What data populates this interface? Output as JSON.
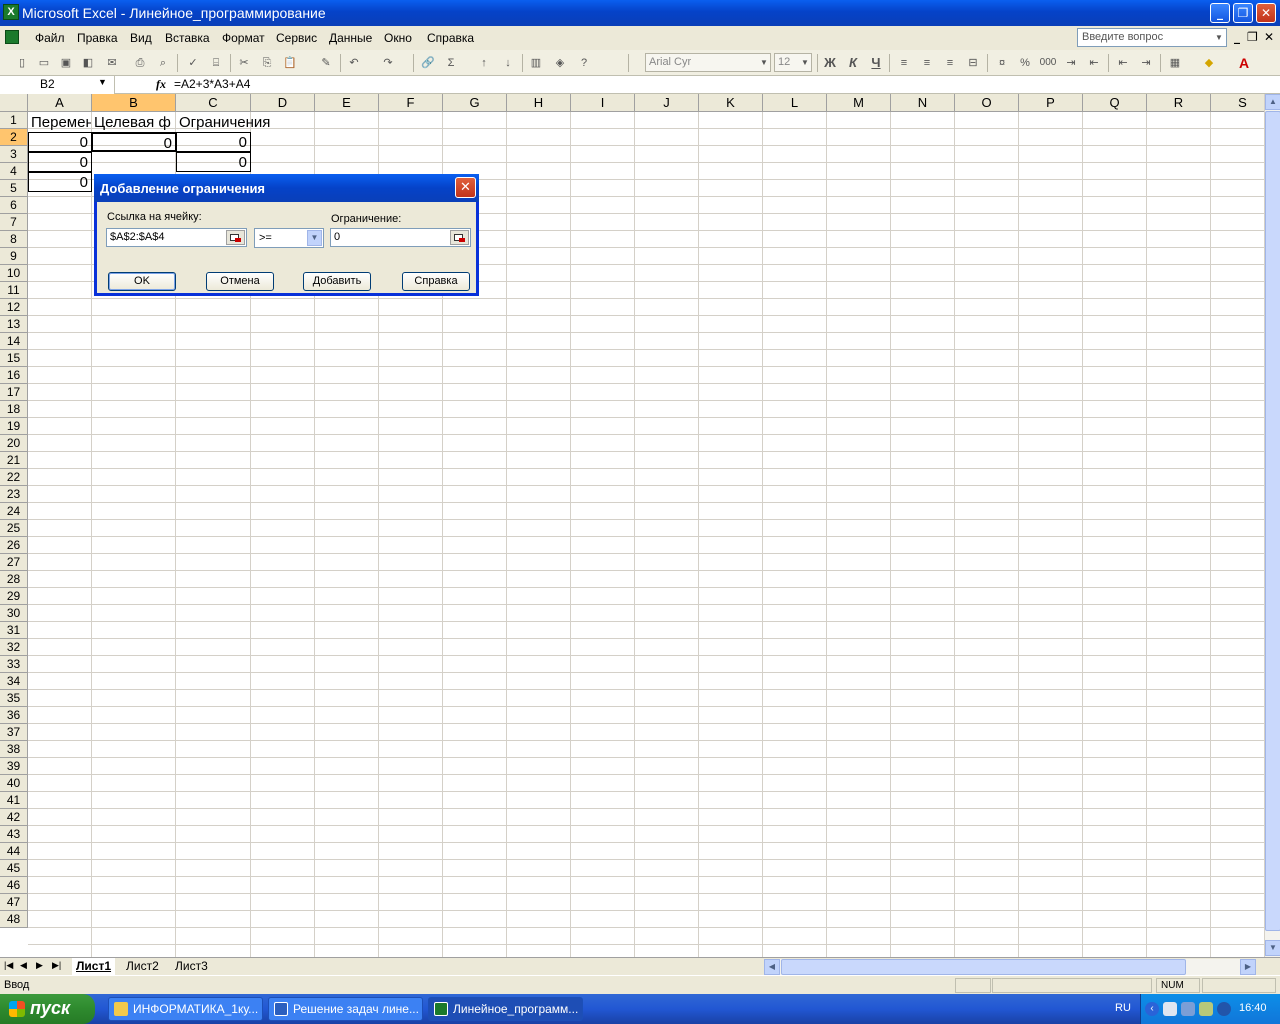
{
  "window": {
    "title": "Microsoft Excel - Линейное_программирование"
  },
  "menu": {
    "items": [
      "Файл",
      "Правка",
      "Вид",
      "Вставка",
      "Формат",
      "Сервис",
      "Данные",
      "Окно",
      "Справка"
    ],
    "help_placeholder": "Введите вопрос"
  },
  "toolbar": {
    "font_name": "Arial Cyr",
    "font_size": "12",
    "bold": "Ж",
    "italic": "К",
    "underline": "Ч",
    "percent": "%",
    "thousands": "000"
  },
  "formula_bar": {
    "name_box": "B2",
    "fx": "fx",
    "formula": "=A2+3*A3+A4"
  },
  "grid": {
    "columns": [
      "A",
      "B",
      "C",
      "D",
      "E",
      "F",
      "G",
      "H",
      "I",
      "J",
      "K",
      "L",
      "M",
      "N",
      "O",
      "P",
      "Q",
      "R",
      "S"
    ],
    "rows": [
      "1",
      "2",
      "3",
      "4",
      "5",
      "6",
      "7",
      "8",
      "9",
      "10",
      "11",
      "12",
      "13",
      "14",
      "15",
      "16",
      "17",
      "18",
      "19",
      "20",
      "21",
      "22",
      "23",
      "24",
      "25",
      "26",
      "27",
      "28",
      "29",
      "30",
      "31",
      "32",
      "33",
      "34",
      "35",
      "36",
      "37",
      "38",
      "39",
      "40",
      "41",
      "42",
      "43",
      "44",
      "45",
      "46",
      "47",
      "48"
    ],
    "cells": {
      "A1": "Переменн",
      "B1": "Целевая ф",
      "C1": "Ограничения",
      "A2": "0",
      "A3": "0",
      "A4": "0",
      "B2": "0",
      "C2": "0",
      "C3": "0"
    }
  },
  "sheet_tabs": [
    "Лист1",
    "Лист2",
    "Лист3"
  ],
  "status_bar": {
    "mode": "Ввод",
    "num": "NUM"
  },
  "dialog": {
    "title": "Добавление ограничения",
    "cell_ref_label": "Ссылка на ячейку:",
    "cell_ref_value": "$A$2:$A$4",
    "operator": ">=",
    "constraint_label": "Ограничение:",
    "constraint_value": "0",
    "buttons": {
      "ok": "OK",
      "cancel": "Отмена",
      "add": "Добавить",
      "help": "Справка"
    }
  },
  "taskbar": {
    "start": "пуск",
    "tasks": [
      "ИНФОРМАТИКА_1ку...",
      "Решение задач лине...",
      "Линейное_программ..."
    ],
    "lang": "RU",
    "time": "16:40"
  }
}
